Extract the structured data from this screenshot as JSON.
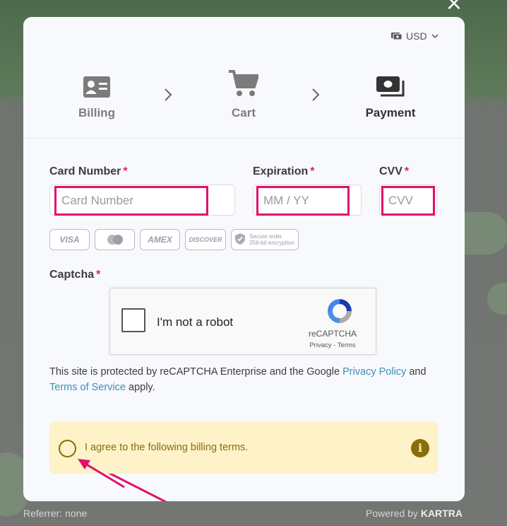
{
  "currency": {
    "label": "USD",
    "icon": "money-icon"
  },
  "steps": [
    {
      "label": "Billing",
      "icon": "id-card-icon",
      "active": false
    },
    {
      "label": "Cart",
      "icon": "cart-icon",
      "active": false
    },
    {
      "label": "Payment",
      "icon": "money-icon",
      "active": true
    }
  ],
  "form": {
    "card_number": {
      "label": "Card Number",
      "required": "*",
      "placeholder": "Card Number",
      "value": ""
    },
    "expiration": {
      "label": "Expiration",
      "required": "*",
      "placeholder": "MM / YY",
      "value": ""
    },
    "cvv": {
      "label": "CVV",
      "required": "*",
      "placeholder": "CVV",
      "value": ""
    }
  },
  "card_brands": [
    "VISA",
    "MC",
    "AMEX",
    "DISCOVER"
  ],
  "secure_badge": {
    "line1": "Secure order",
    "line2": "256-bit encryption"
  },
  "captcha": {
    "label": "Captcha",
    "required": "*",
    "checkbox_text": "I'm not a robot",
    "brand": "reCAPTCHA",
    "privacy": "Privacy",
    "separator": " - ",
    "terms": "Terms"
  },
  "notice": {
    "prefix": "This site is protected by reCAPTCHA Enterprise and the Google ",
    "privacy_link": "Privacy Policy",
    "middle": " and ",
    "terms_link": "Terms of Service",
    "suffix": " apply."
  },
  "billing_terms": {
    "text": "I agree to the following billing terms.",
    "info_icon": "i"
  },
  "footer": {
    "referrer": "Referrer: none",
    "powered_prefix": "Powered by ",
    "powered_brand": "KARTRA"
  },
  "colors": {
    "accent": "#e0106c",
    "required": "#d7255b",
    "link": "#3c8fb8",
    "terms_bg": "#fdf2c8",
    "terms_fg": "#8a6d0b"
  }
}
